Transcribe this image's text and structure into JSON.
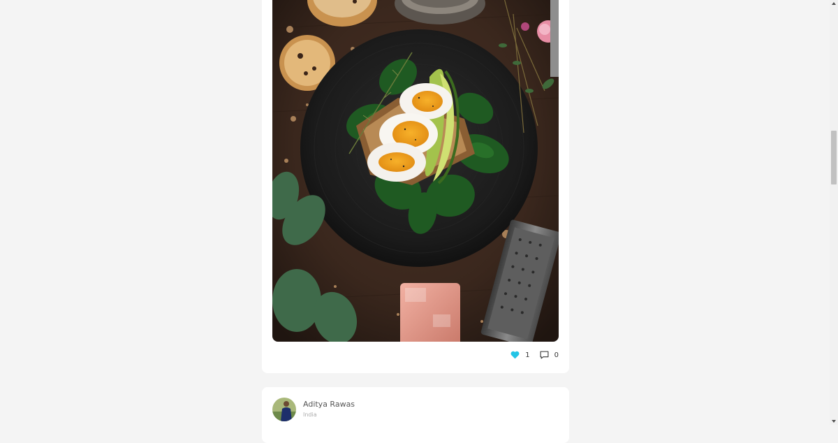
{
  "posts": [
    {
      "image": {
        "subject": "food-photo",
        "alt": ""
      },
      "likes": "1",
      "comments": "0",
      "colors": {
        "like_icon": "#22c4e6"
      }
    },
    {
      "author": {
        "name": "Aditya Rawas",
        "location": "India"
      }
    }
  ],
  "colors": {
    "page_background": "#f4f4f4",
    "card_background": "#ffffff",
    "accent": "#22c4e6"
  }
}
